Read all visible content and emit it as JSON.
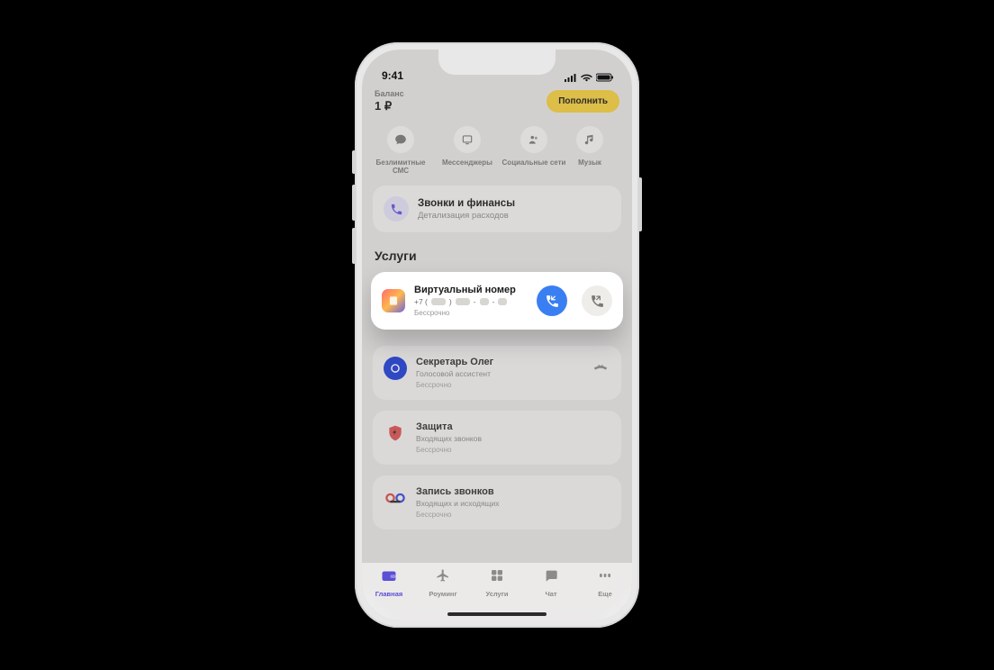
{
  "status": {
    "time": "9:41"
  },
  "header": {
    "balance_label": "Баланс",
    "balance_value": "1 ₽",
    "topup": "Пополнить"
  },
  "quick": [
    {
      "label": "Безлимитные СМС",
      "icon": "chat-bubble-icon"
    },
    {
      "label": "Мессенджеры",
      "icon": "messenger-icon"
    },
    {
      "label": "Социальные сети",
      "icon": "social-icon"
    },
    {
      "label": "Музык",
      "icon": "music-icon"
    }
  ],
  "finance": {
    "title": "Звонки и финансы",
    "sub": "Детализация расходов"
  },
  "section_title": "Услуги",
  "virtual": {
    "title": "Виртуальный номер",
    "prefix": "+7 (",
    "sep1": ") ",
    "sep2": "-",
    "sep3": "-",
    "note": "Бессрочно"
  },
  "services": [
    {
      "title": "Секретарь Олег",
      "sub": "Голосовой ассистент",
      "note": "Бессрочно",
      "icon": "letter-o-icon",
      "right": "missed-call-icon"
    },
    {
      "title": "Защита",
      "sub": "Входящих звонков",
      "note": "Бессрочно",
      "icon": "shield-icon",
      "right": ""
    },
    {
      "title": "Запись звонков",
      "sub": "Входящих и исходящих",
      "note": "Бессрочно",
      "icon": "voicemail-icon",
      "right": ""
    }
  ],
  "tabs": [
    {
      "label": "Главная",
      "icon": "wallet-icon",
      "active": true
    },
    {
      "label": "Роуминг",
      "icon": "plane-icon",
      "active": false
    },
    {
      "label": "Услуги",
      "icon": "grid-icon",
      "active": false
    },
    {
      "label": "Чат",
      "icon": "chat-icon",
      "active": false
    },
    {
      "label": "Еще",
      "icon": "more-icon",
      "active": false
    }
  ]
}
